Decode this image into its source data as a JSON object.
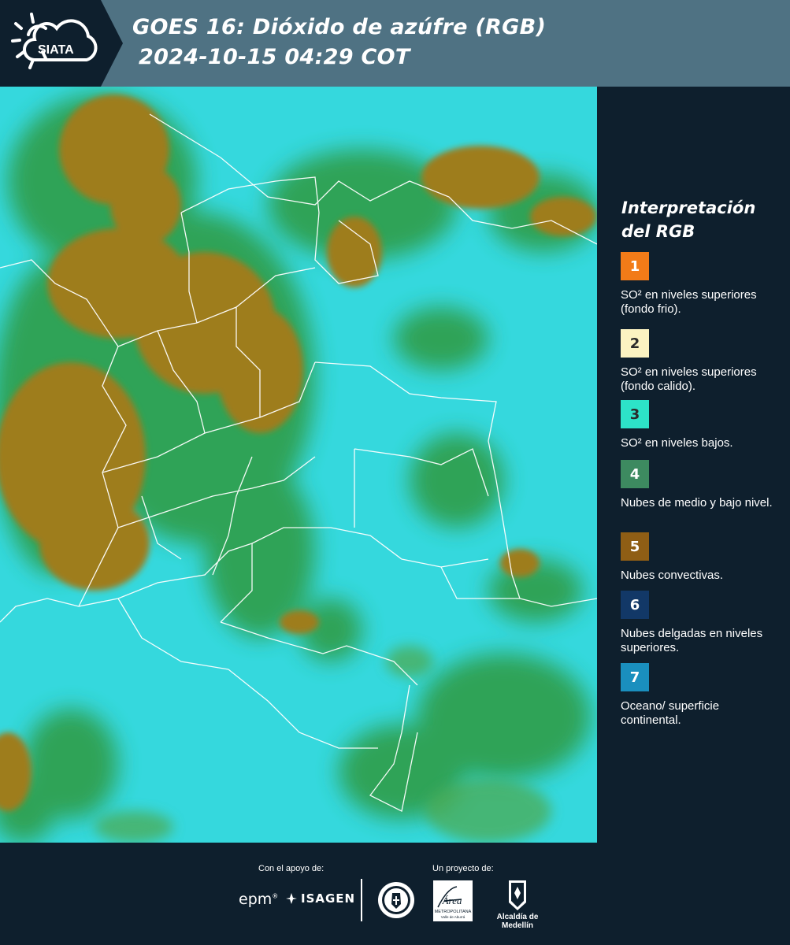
{
  "header": {
    "logo_text": "SIATA",
    "title_line1": "GOES 16: Dióxido de azúfre (RGB)",
    "title_line2": "2024-10-15 04:29 COT",
    "background_color": "#4f7283",
    "logo_background_color": "#0e1f2d"
  },
  "map": {
    "type": "satellite-rgb-composite",
    "dominant_colors": {
      "surface": "#33d9de",
      "convective_clouds": "#9e7d1e",
      "mid_low_clouds": "#2f9a3f"
    },
    "borders_color": "#ffffff"
  },
  "legend": {
    "title": "Interpretación del RGB",
    "items": [
      {
        "number": "1",
        "label": "SO² en niveles superiores (fondo frio).",
        "color": "#f27b18",
        "text_color": "#ffffff"
      },
      {
        "number": "2",
        "label": "SO² en niveles superiores (fondo calido).",
        "color": "#fbf3c2",
        "text_color": "#2a2a2a"
      },
      {
        "number": "3",
        "label": "SO² en niveles bajos.",
        "color": "#2de3c8",
        "text_color": "#2a2a2a"
      },
      {
        "number": "4",
        "label": "Nubes de medio y bajo nivel.",
        "color": "#3d8a60",
        "text_color": "#ffffff"
      },
      {
        "number": "5",
        "label": "Nubes convectivas.",
        "color": "#8f5e15",
        "text_color": "#ffffff"
      },
      {
        "number": "6",
        "label": "Nubes delgadas en niveles superiores.",
        "color": "#123867",
        "text_color": "#ffffff"
      },
      {
        "number": "7",
        "label": "Oceano/ superficie continental.",
        "color": "#1a8fbe",
        "text_color": "#ffffff"
      }
    ]
  },
  "footer": {
    "support_label": "Con el apoyo de:",
    "project_label": "Un proyecto de:",
    "epm_text": "epm",
    "isagen_text": "ISAGEN",
    "area_logo_text": "Área",
    "area_logo_subtext": "METROPOLITANA",
    "area_logo_subtext2": "Valle de Aburrá",
    "alcaldia_text": "Alcaldía de Medellín"
  }
}
